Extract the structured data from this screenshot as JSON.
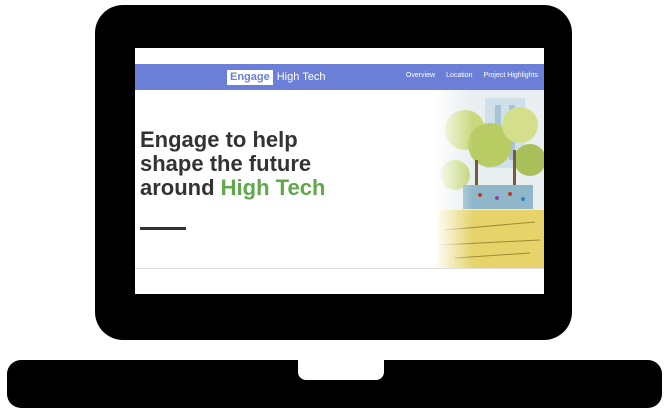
{
  "navbar": {
    "brand_box": "Engage",
    "brand_text": "High Tech",
    "links": [
      "Overview",
      "Location",
      "Project Highlights"
    ]
  },
  "hero": {
    "line1": "Engage to help",
    "line2": "shape the future",
    "line3_prefix": "around ",
    "line3_highlight": "High Tech"
  },
  "colors": {
    "nav_bg": "#6c7fd8",
    "highlight": "#5fa84c",
    "device": "#000000"
  }
}
